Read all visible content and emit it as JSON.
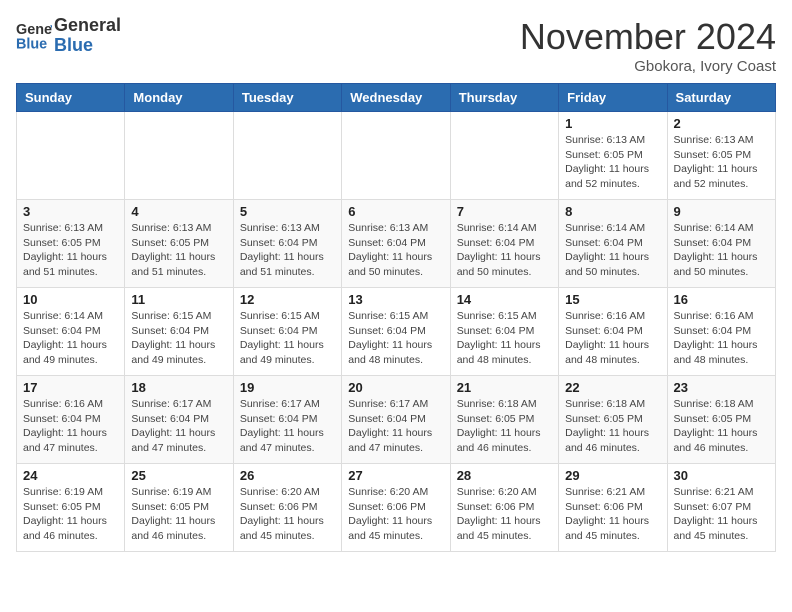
{
  "header": {
    "logo_general": "General",
    "logo_blue": "Blue",
    "month_title": "November 2024",
    "location": "Gbokora, Ivory Coast"
  },
  "calendar": {
    "days_of_week": [
      "Sunday",
      "Monday",
      "Tuesday",
      "Wednesday",
      "Thursday",
      "Friday",
      "Saturday"
    ],
    "weeks": [
      [
        {
          "day": "",
          "info": ""
        },
        {
          "day": "",
          "info": ""
        },
        {
          "day": "",
          "info": ""
        },
        {
          "day": "",
          "info": ""
        },
        {
          "day": "",
          "info": ""
        },
        {
          "day": "1",
          "info": "Sunrise: 6:13 AM\nSunset: 6:05 PM\nDaylight: 11 hours and 52 minutes."
        },
        {
          "day": "2",
          "info": "Sunrise: 6:13 AM\nSunset: 6:05 PM\nDaylight: 11 hours and 52 minutes."
        }
      ],
      [
        {
          "day": "3",
          "info": "Sunrise: 6:13 AM\nSunset: 6:05 PM\nDaylight: 11 hours and 51 minutes."
        },
        {
          "day": "4",
          "info": "Sunrise: 6:13 AM\nSunset: 6:05 PM\nDaylight: 11 hours and 51 minutes."
        },
        {
          "day": "5",
          "info": "Sunrise: 6:13 AM\nSunset: 6:04 PM\nDaylight: 11 hours and 51 minutes."
        },
        {
          "day": "6",
          "info": "Sunrise: 6:13 AM\nSunset: 6:04 PM\nDaylight: 11 hours and 50 minutes."
        },
        {
          "day": "7",
          "info": "Sunrise: 6:14 AM\nSunset: 6:04 PM\nDaylight: 11 hours and 50 minutes."
        },
        {
          "day": "8",
          "info": "Sunrise: 6:14 AM\nSunset: 6:04 PM\nDaylight: 11 hours and 50 minutes."
        },
        {
          "day": "9",
          "info": "Sunrise: 6:14 AM\nSunset: 6:04 PM\nDaylight: 11 hours and 50 minutes."
        }
      ],
      [
        {
          "day": "10",
          "info": "Sunrise: 6:14 AM\nSunset: 6:04 PM\nDaylight: 11 hours and 49 minutes."
        },
        {
          "day": "11",
          "info": "Sunrise: 6:15 AM\nSunset: 6:04 PM\nDaylight: 11 hours and 49 minutes."
        },
        {
          "day": "12",
          "info": "Sunrise: 6:15 AM\nSunset: 6:04 PM\nDaylight: 11 hours and 49 minutes."
        },
        {
          "day": "13",
          "info": "Sunrise: 6:15 AM\nSunset: 6:04 PM\nDaylight: 11 hours and 48 minutes."
        },
        {
          "day": "14",
          "info": "Sunrise: 6:15 AM\nSunset: 6:04 PM\nDaylight: 11 hours and 48 minutes."
        },
        {
          "day": "15",
          "info": "Sunrise: 6:16 AM\nSunset: 6:04 PM\nDaylight: 11 hours and 48 minutes."
        },
        {
          "day": "16",
          "info": "Sunrise: 6:16 AM\nSunset: 6:04 PM\nDaylight: 11 hours and 48 minutes."
        }
      ],
      [
        {
          "day": "17",
          "info": "Sunrise: 6:16 AM\nSunset: 6:04 PM\nDaylight: 11 hours and 47 minutes."
        },
        {
          "day": "18",
          "info": "Sunrise: 6:17 AM\nSunset: 6:04 PM\nDaylight: 11 hours and 47 minutes."
        },
        {
          "day": "19",
          "info": "Sunrise: 6:17 AM\nSunset: 6:04 PM\nDaylight: 11 hours and 47 minutes."
        },
        {
          "day": "20",
          "info": "Sunrise: 6:17 AM\nSunset: 6:04 PM\nDaylight: 11 hours and 47 minutes."
        },
        {
          "day": "21",
          "info": "Sunrise: 6:18 AM\nSunset: 6:05 PM\nDaylight: 11 hours and 46 minutes."
        },
        {
          "day": "22",
          "info": "Sunrise: 6:18 AM\nSunset: 6:05 PM\nDaylight: 11 hours and 46 minutes."
        },
        {
          "day": "23",
          "info": "Sunrise: 6:18 AM\nSunset: 6:05 PM\nDaylight: 11 hours and 46 minutes."
        }
      ],
      [
        {
          "day": "24",
          "info": "Sunrise: 6:19 AM\nSunset: 6:05 PM\nDaylight: 11 hours and 46 minutes."
        },
        {
          "day": "25",
          "info": "Sunrise: 6:19 AM\nSunset: 6:05 PM\nDaylight: 11 hours and 46 minutes."
        },
        {
          "day": "26",
          "info": "Sunrise: 6:20 AM\nSunset: 6:06 PM\nDaylight: 11 hours and 45 minutes."
        },
        {
          "day": "27",
          "info": "Sunrise: 6:20 AM\nSunset: 6:06 PM\nDaylight: 11 hours and 45 minutes."
        },
        {
          "day": "28",
          "info": "Sunrise: 6:20 AM\nSunset: 6:06 PM\nDaylight: 11 hours and 45 minutes."
        },
        {
          "day": "29",
          "info": "Sunrise: 6:21 AM\nSunset: 6:06 PM\nDaylight: 11 hours and 45 minutes."
        },
        {
          "day": "30",
          "info": "Sunrise: 6:21 AM\nSunset: 6:07 PM\nDaylight: 11 hours and 45 minutes."
        }
      ]
    ]
  }
}
